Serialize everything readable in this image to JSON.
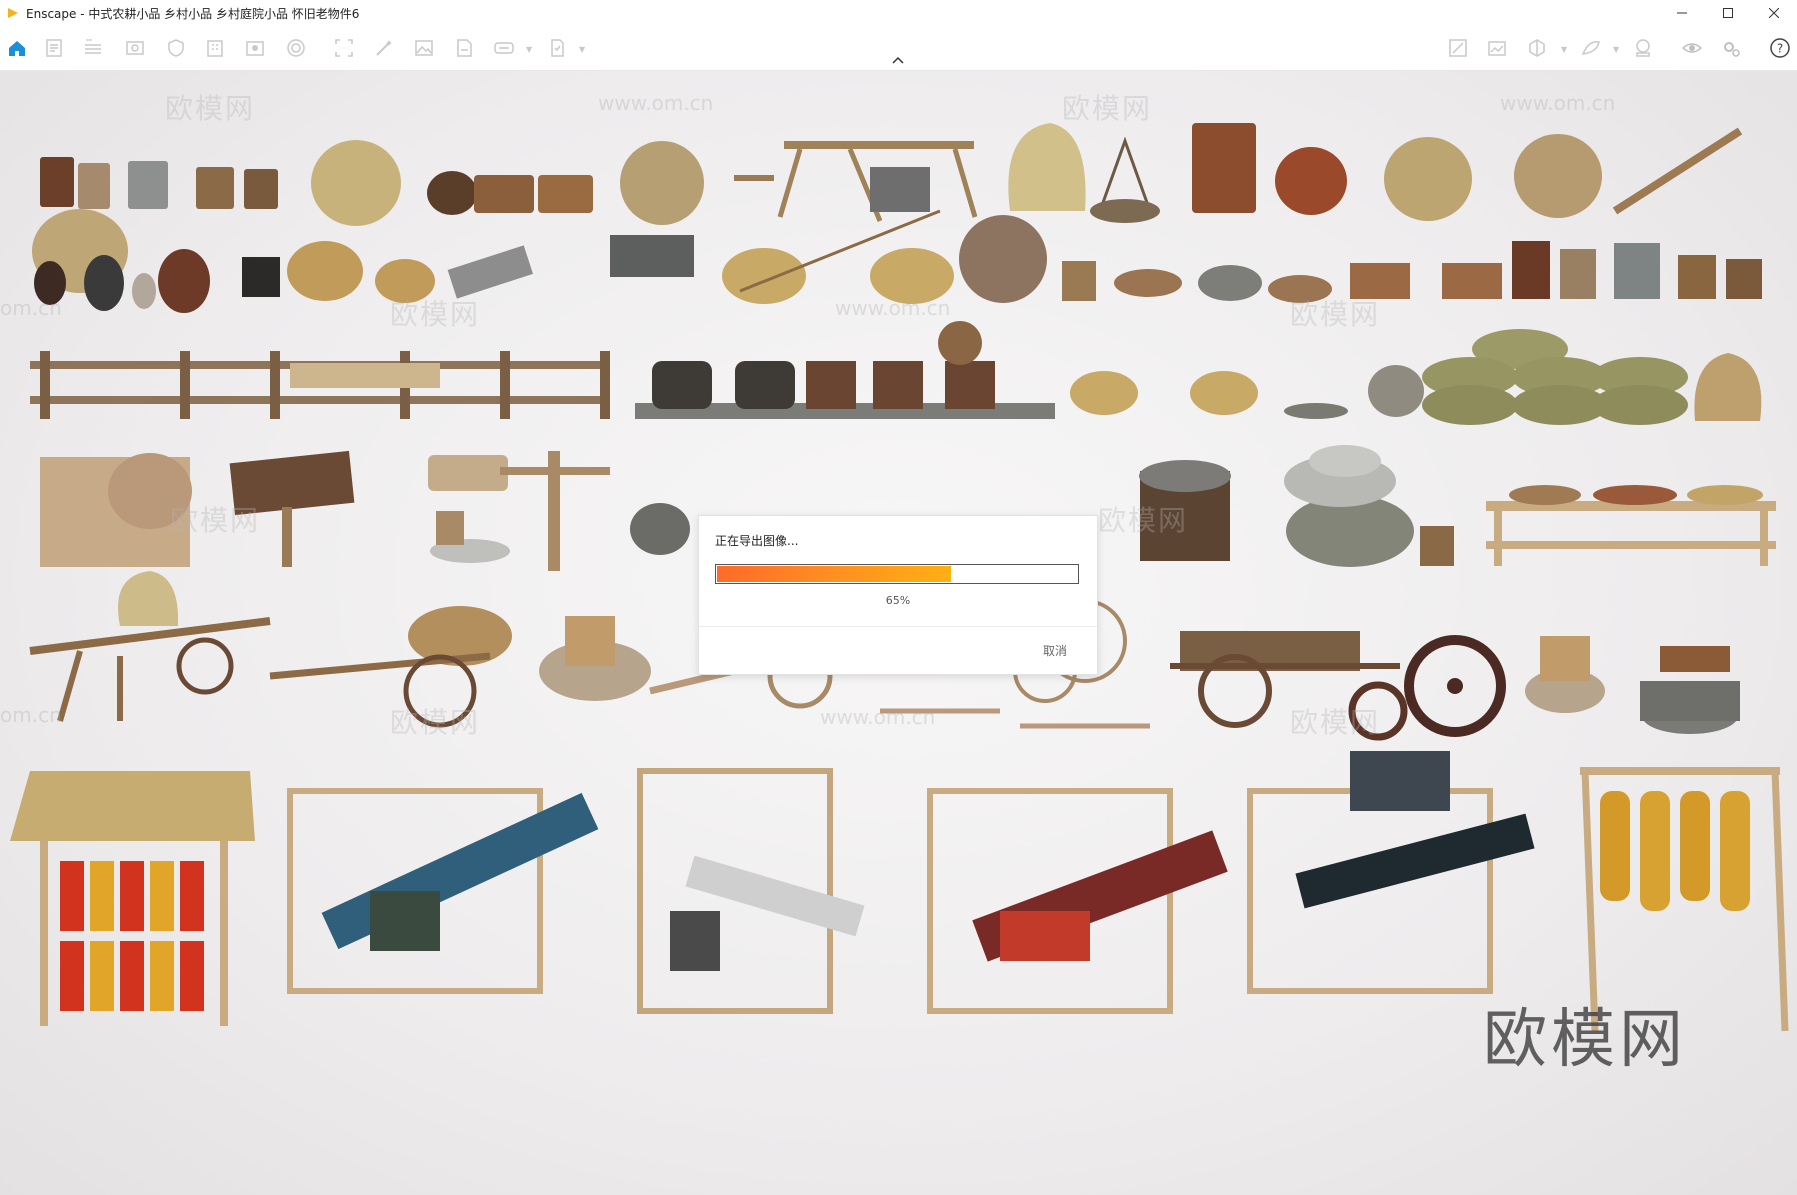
{
  "window": {
    "title": "Enscape - 中式农耕小品 乡村小品 乡村庭院小品 怀旧老物件6"
  },
  "toolbar": {
    "left_icons": [
      "home-icon",
      "document-icon",
      "bim-list-icon",
      "view-icon",
      "shield-icon",
      "building-icon",
      "book-icon",
      "sphere-icon",
      "crop-icon",
      "magic-wand-icon",
      "image-icon",
      "export-pdf-icon",
      "panorama-360-icon",
      "batch-export-icon"
    ],
    "right_icons": [
      "asset-library-icon",
      "screenshot-icon",
      "cube-icon",
      "material-icon",
      "vr-headset-icon",
      "eye-icon",
      "settings-icon",
      "help-icon"
    ],
    "accent_color": "#1b8fd9"
  },
  "watermarks": {
    "brand": "欧模网",
    "url": "www.om.cn",
    "url_alt": "om.cn"
  },
  "export_dialog": {
    "title": "正在导出图像...",
    "progress_percent": 65,
    "progress_label": "65%",
    "cancel_label": "取消"
  }
}
